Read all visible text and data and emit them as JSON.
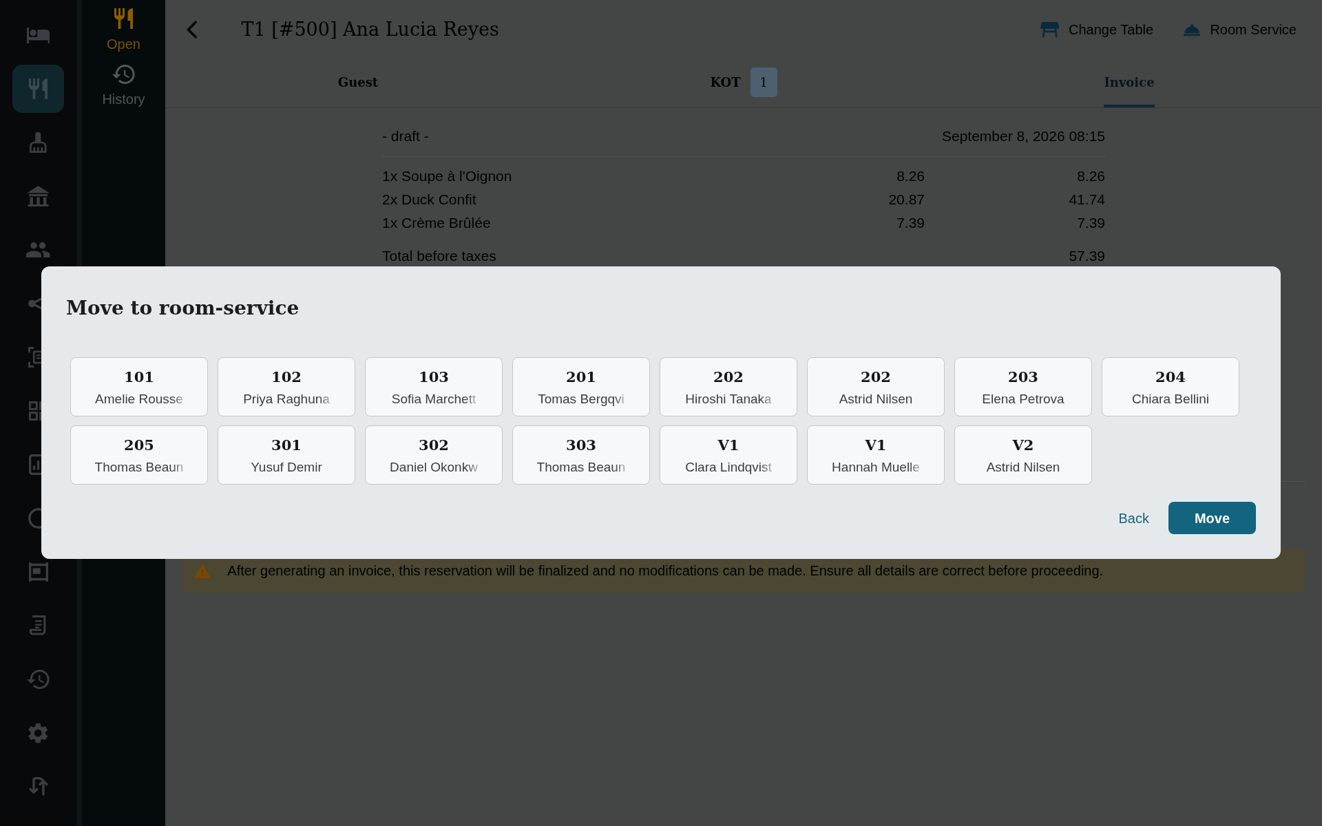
{
  "rail": [
    {
      "selected": false
    },
    {
      "selected": true
    },
    {
      "selected": false
    },
    {
      "selected": false
    },
    {
      "selected": false
    },
    {
      "selected": false
    },
    {
      "selected": false
    },
    {
      "selected": false
    },
    {
      "selected": false
    },
    {
      "selected": false
    },
    {
      "selected": false
    },
    {
      "selected": false
    },
    {
      "selected": false
    },
    {
      "selected": false
    },
    {
      "selected": false
    }
  ],
  "sidebar": [
    {
      "label": "Open",
      "selected": true
    },
    {
      "label": "History",
      "selected": false
    }
  ],
  "header": {
    "title": "T1 [#500] Ana Lucia Reyes",
    "actions": [
      {
        "label": "Change Table"
      },
      {
        "label": "Room Service"
      }
    ]
  },
  "tabs": [
    {
      "label": "Guest",
      "selected": false
    },
    {
      "label": "KOT",
      "badge": "1",
      "selected": false
    },
    {
      "label": "Invoice",
      "selected": true
    }
  ],
  "invoice": {
    "status": "- draft -",
    "date": "September 8, 2026 08:15",
    "lines": [
      {
        "item": "1x Soupe à l'Oignon",
        "unit_price": "8.26",
        "amount": "8.26"
      },
      {
        "item": "2x Duck Confit",
        "unit_price": "20.87",
        "amount": "41.74"
      },
      {
        "item": "1x Crème Brûlée",
        "unit_price": "7.39",
        "amount": "7.39"
      }
    ],
    "subtotal": {
      "label": "Total before taxes",
      "amount": "57.39"
    }
  },
  "notice": {
    "text": "After generating an invoice, this reservation will be finalized and no modifications can be made. Ensure all details are correct before proceeding."
  },
  "modal": {
    "title": "Move to room-service",
    "rooms": [
      {
        "number": "101",
        "guest": "Amelie Rousse",
        "truncated": true,
        "selected": false
      },
      {
        "number": "102",
        "guest": "Priya Raghuna",
        "truncated": true,
        "selected": false
      },
      {
        "number": "103",
        "guest": "Sofia Marchett",
        "truncated": true,
        "selected": false
      },
      {
        "number": "201",
        "guest": "Tomas Bergqvi",
        "truncated": true,
        "selected": false
      },
      {
        "number": "202",
        "guest": "Hiroshi Tanaka",
        "truncated": true,
        "selected": false
      },
      {
        "number": "202",
        "guest": "Astrid Nilsen",
        "truncated": false,
        "selected": false
      },
      {
        "number": "203",
        "guest": "Elena Petrova",
        "truncated": false,
        "selected": false
      },
      {
        "number": "204",
        "guest": "Chiara Bellini",
        "truncated": false,
        "selected": false
      },
      {
        "number": "205",
        "guest": "Thomas Beaun",
        "truncated": true,
        "selected": false
      },
      {
        "number": "301",
        "guest": "Yusuf Demir",
        "truncated": false,
        "selected": false
      },
      {
        "number": "302",
        "guest": "Daniel Okonkw",
        "truncated": true,
        "selected": false
      },
      {
        "number": "303",
        "guest": "Thomas Beaun",
        "truncated": true,
        "selected": false
      },
      {
        "number": "V1",
        "guest": "Clara Lindqvist",
        "truncated": true,
        "selected": false
      },
      {
        "number": "V1",
        "guest": "Hannah Muelle",
        "truncated": true,
        "selected": false
      },
      {
        "number": "V2",
        "guest": "Astrid Nilsen",
        "truncated": false,
        "selected": false
      }
    ],
    "actions": [
      {
        "label": "Back",
        "kind": "link"
      },
      {
        "label": "Move",
        "kind": "primary"
      }
    ]
  }
}
